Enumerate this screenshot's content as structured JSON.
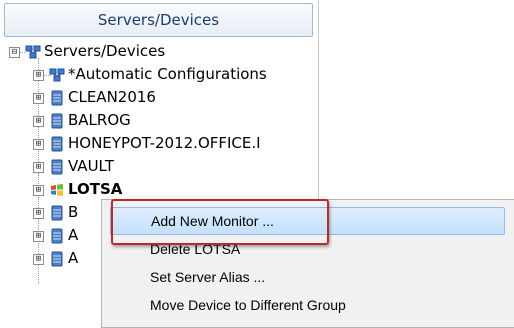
{
  "panel": {
    "title": "Servers/Devices"
  },
  "tree": {
    "root": {
      "label": "Servers/Devices",
      "expander": "⊟",
      "icon": "network-group-icon"
    },
    "children": [
      {
        "label": "*Automatic Configurations",
        "expander": "⊞",
        "icon": "network-group-icon"
      },
      {
        "label": "CLEAN2016",
        "expander": "⊞",
        "icon": "server-icon"
      },
      {
        "label": "BALROG",
        "expander": "⊞",
        "icon": "server-icon"
      },
      {
        "label": "HONEYPOT-2012.OFFICE.I",
        "expander": "⊞",
        "icon": "server-icon"
      },
      {
        "label": "VAULT",
        "expander": "⊞",
        "icon": "server-icon"
      },
      {
        "label": "LOTSA",
        "expander": "⊞",
        "icon": "windows-server-icon"
      },
      {
        "label": "B",
        "expander": "⊞",
        "icon": "server-icon"
      },
      {
        "label": "A",
        "expander": "⊞",
        "icon": "server-icon"
      },
      {
        "label": "A",
        "expander": "⊞",
        "icon": "server-icon"
      }
    ]
  },
  "context_menu": {
    "items": [
      {
        "label": "Add New Monitor ..."
      },
      {
        "label": "Delete LOTSA"
      },
      {
        "label": "Set Server Alias ..."
      },
      {
        "label": "Move Device to Different Group"
      }
    ],
    "highlighted_index": 0
  },
  "colors": {
    "highlight": "#c4e0fb",
    "annotation_frame": "#c0262e",
    "header_text": "#1c3b6e"
  }
}
